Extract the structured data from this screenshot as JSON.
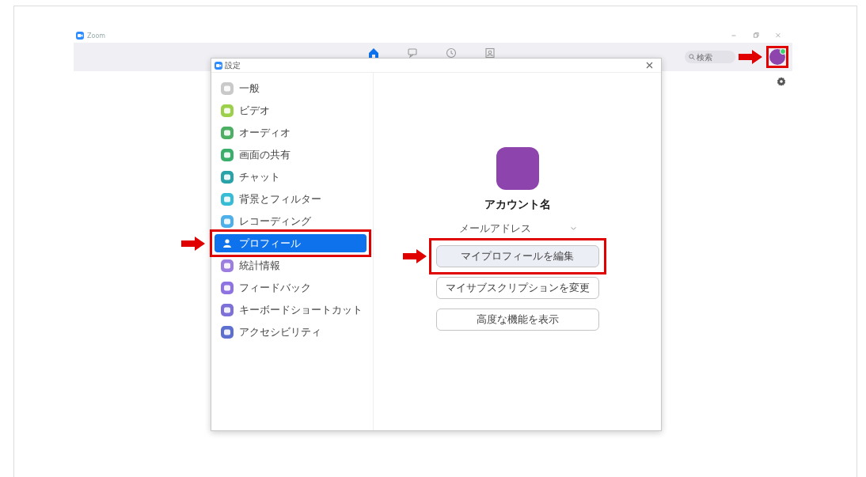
{
  "app": {
    "title": "Zoom",
    "search": {
      "placeholder": "検索"
    },
    "avatar": {
      "highlighted": true
    }
  },
  "settings_dialog": {
    "title": "設定",
    "sidebar": {
      "items": [
        {
          "label": "一般",
          "color": "#c9c9c9",
          "selected": false,
          "highlighted": false
        },
        {
          "label": "ビデオ",
          "color": "#9ccf4a",
          "selected": false,
          "highlighted": false
        },
        {
          "label": "オーディオ",
          "color": "#4caf63",
          "selected": false,
          "highlighted": false
        },
        {
          "label": "画面の共有",
          "color": "#3aae6a",
          "selected": false,
          "highlighted": false
        },
        {
          "label": "チャット",
          "color": "#2aa3a8",
          "selected": false,
          "highlighted": false
        },
        {
          "label": "背景とフィルター",
          "color": "#37bcd6",
          "selected": false,
          "highlighted": false
        },
        {
          "label": "レコーディング",
          "color": "#4db0ea",
          "selected": false,
          "highlighted": false
        },
        {
          "label": "プロフィール",
          "color": "#ffffff",
          "selected": true,
          "highlighted": true
        },
        {
          "label": "統計情報",
          "color": "#9c7ee0",
          "selected": false,
          "highlighted": false
        },
        {
          "label": "フィードバック",
          "color": "#8f72e2",
          "selected": false,
          "highlighted": false
        },
        {
          "label": "キーボードショートカット",
          "color": "#7d70d8",
          "selected": false,
          "highlighted": false
        },
        {
          "label": "アクセシビリティ",
          "color": "#5d70cf",
          "selected": false,
          "highlighted": false
        }
      ]
    },
    "profile": {
      "name": "アカウント名",
      "email": "メールアドレス",
      "buttons": [
        {
          "label": "マイプロフィールを編集",
          "highlighted": true
        },
        {
          "label": "マイサブスクリプションを変更",
          "highlighted": false
        },
        {
          "label": "高度な機能を表示",
          "highlighted": false
        }
      ]
    }
  }
}
